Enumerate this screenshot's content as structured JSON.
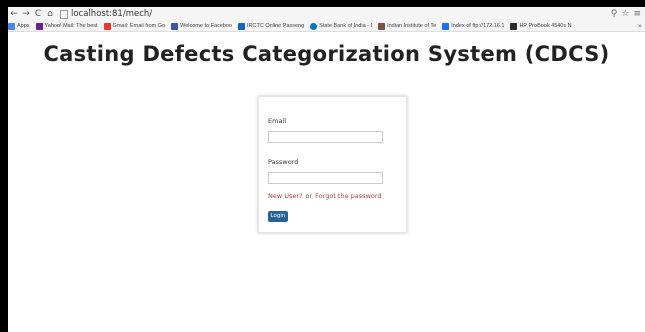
{
  "browser": {
    "url": "localhost:81/mech/",
    "nav": {
      "back": "←",
      "forward": "→",
      "reload": "C",
      "home": "⌂"
    },
    "toolbar_icons": {
      "search": "⚲",
      "star": "☆",
      "menu": "≡"
    }
  },
  "bookmarks": [
    {
      "label": "Apps",
      "color": "#4a86e8"
    },
    {
      "label": "Yahoo! Mail: The best",
      "color": "#6a1b9a"
    },
    {
      "label": "Gmail: Email from Go",
      "color": "#e53935"
    },
    {
      "label": "Welcome to Faceboo",
      "color": "#3b5998"
    },
    {
      "label": "IRCTC Online Passeng",
      "color": "#1565c0"
    },
    {
      "label": "State Bank of India - I",
      "color": "#0277bd"
    },
    {
      "label": "Indian Institute of Te",
      "color": "#795548"
    },
    {
      "label": "Index of ftp://172.16.1",
      "color": "#1a73e8"
    },
    {
      "label": "HP ProBook 4540s N",
      "color": "#2b2b2b"
    }
  ],
  "bookmarks_more": "»",
  "page": {
    "title": "Casting Defects Categorization System (CDCS)"
  },
  "login": {
    "email_label": "Email",
    "email_value": "",
    "password_label": "Password",
    "password_value": "",
    "new_user_link": "New User?",
    "or_text": "or",
    "forgot_link": "Forgot the password",
    "login_button": "Login"
  }
}
